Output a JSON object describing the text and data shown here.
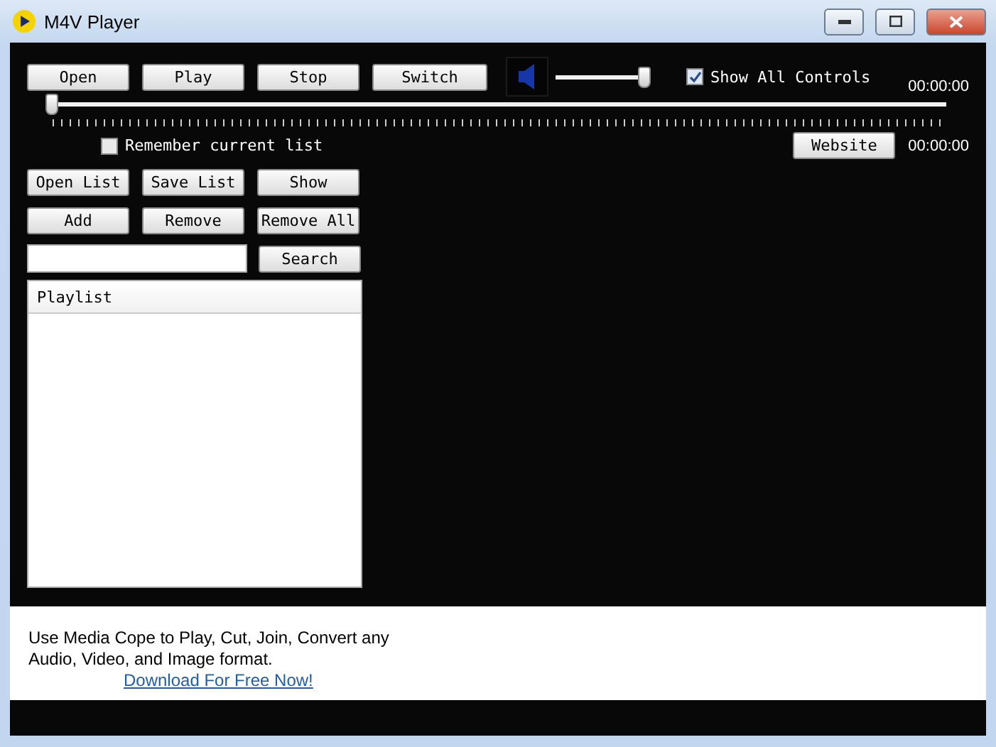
{
  "window": {
    "title": "M4V Player"
  },
  "transport_buttons": [
    "Open",
    "Play",
    "Stop",
    "Switch"
  ],
  "volume": {
    "level": 0.95
  },
  "show_all_controls": {
    "label": "Show All Controls",
    "checked": true
  },
  "time_top": "00:00:00",
  "seek": {
    "level": 0
  },
  "remember_list": {
    "label": "Remember current list",
    "checked": false
  },
  "website_button": "Website",
  "time_bottom": "00:00:00",
  "list_buttons": [
    [
      "Open List",
      "Save List",
      "Show"
    ],
    [
      "Add",
      "Remove",
      "Remove All"
    ]
  ],
  "search_button": "Search",
  "playlist": {
    "header": "Playlist"
  },
  "ad": {
    "text": "Use Media Cope to Play, Cut, Join, Convert any\nAudio, Video, and Image format.",
    "link": "Download For Free Now!"
  }
}
